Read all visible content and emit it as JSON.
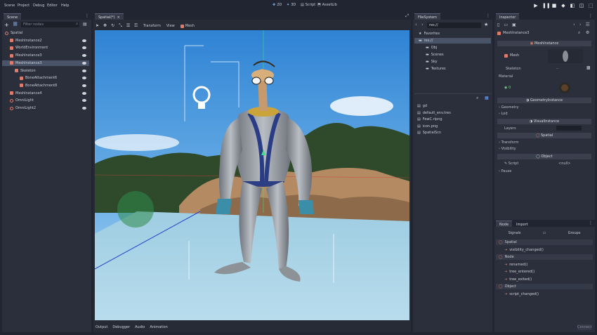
{
  "menu": [
    "Scene",
    "Project",
    "Debug",
    "Editor",
    "Help"
  ],
  "toolbar": {
    "btn2d": "2D",
    "btn3d": "3D",
    "script": "Script",
    "assetlib": "AssetLib"
  },
  "colors": {
    "bg": "#202531",
    "panel": "#2a2f3b",
    "accent": "#e0a060",
    "selection": "#4a5468",
    "sky": "#3e8fd8",
    "floor": "#a9d4e6"
  },
  "scene": {
    "tab": "Scene",
    "filter_placeholder": "Filter nodes",
    "nodes": [
      {
        "label": "Spatial",
        "depth": 0,
        "icon": "spatial-icon"
      },
      {
        "label": "MeshInstance2",
        "depth": 1,
        "icon": "mesh-icon"
      },
      {
        "label": "WorldEnvironment",
        "depth": 1,
        "icon": "world-icon"
      },
      {
        "label": "MeshInstance3",
        "depth": 1,
        "icon": "mesh-icon"
      },
      {
        "label": "MeshInstance3",
        "depth": 1,
        "icon": "mesh-icon",
        "selected": true
      },
      {
        "label": "Skeleton",
        "depth": 2,
        "icon": "skeleton-icon"
      },
      {
        "label": "BoneAttachment6",
        "depth": 3,
        "icon": "bone-icon"
      },
      {
        "label": "BoneAttachment8",
        "depth": 3,
        "icon": "bone-icon"
      },
      {
        "label": "MeshInstance4",
        "depth": 1,
        "icon": "mesh-icon"
      },
      {
        "label": "OmniLight",
        "depth": 1,
        "icon": "light-icon"
      },
      {
        "label": "OmniLight2",
        "depth": 1,
        "icon": "light-icon"
      }
    ]
  },
  "viewport": {
    "tab": "Spatial(*)",
    "menus": [
      "Transform",
      "View",
      "Mesh"
    ],
    "bottom_tabs": [
      "Output",
      "Debugger",
      "Audio",
      "Animation"
    ]
  },
  "filesystem": {
    "tab": "FileSystem",
    "path": "res://",
    "tree": [
      {
        "label": "Favorites",
        "depth": 0
      },
      {
        "label": "res://",
        "depth": 0,
        "selected": true
      },
      {
        "label": "Obj",
        "depth": 1
      },
      {
        "label": "Scenes",
        "depth": 1
      },
      {
        "label": "Sky",
        "depth": 1
      },
      {
        "label": "Textures",
        "depth": 1
      }
    ],
    "files": [
      "gd",
      "default_env.tres",
      "FewC.ripng",
      "icon.png",
      "SpatialScn"
    ]
  },
  "inspector": {
    "tab": "Inspector",
    "object_name": "MeshInstance3",
    "sections": {
      "mesh_instance": "MeshInstance",
      "geometry_instance": "GeometryInstance",
      "visual_instance": "VisualInstance",
      "spatial": "Spatial",
      "object": "Object"
    },
    "props": {
      "mesh": "Mesh",
      "skeleton": "Skeleton",
      "skeleton_value": "..",
      "material": "Material",
      "material_index": "0",
      "geometry": "Geometry",
      "lod": "Lod",
      "layers": "Layers",
      "transform": "Transform",
      "visibility": "Visibility",
      "script": "Script",
      "script_value": "<null>",
      "pause": "Pause"
    }
  },
  "node_panel": {
    "tabs": [
      "Node",
      "Import"
    ],
    "sub": [
      "Signals",
      "Groups"
    ],
    "entries": [
      {
        "label": "Spatial",
        "kind": "class"
      },
      {
        "label": "visibility_changed()",
        "kind": "signal"
      },
      {
        "label": "Node",
        "kind": "class"
      },
      {
        "label": "renamed()",
        "kind": "signal"
      },
      {
        "label": "tree_entered()",
        "kind": "signal"
      },
      {
        "label": "tree_exited()",
        "kind": "signal"
      },
      {
        "label": "Object",
        "kind": "class"
      },
      {
        "label": "script_changed()",
        "kind": "signal"
      }
    ],
    "connect": "Connect"
  }
}
